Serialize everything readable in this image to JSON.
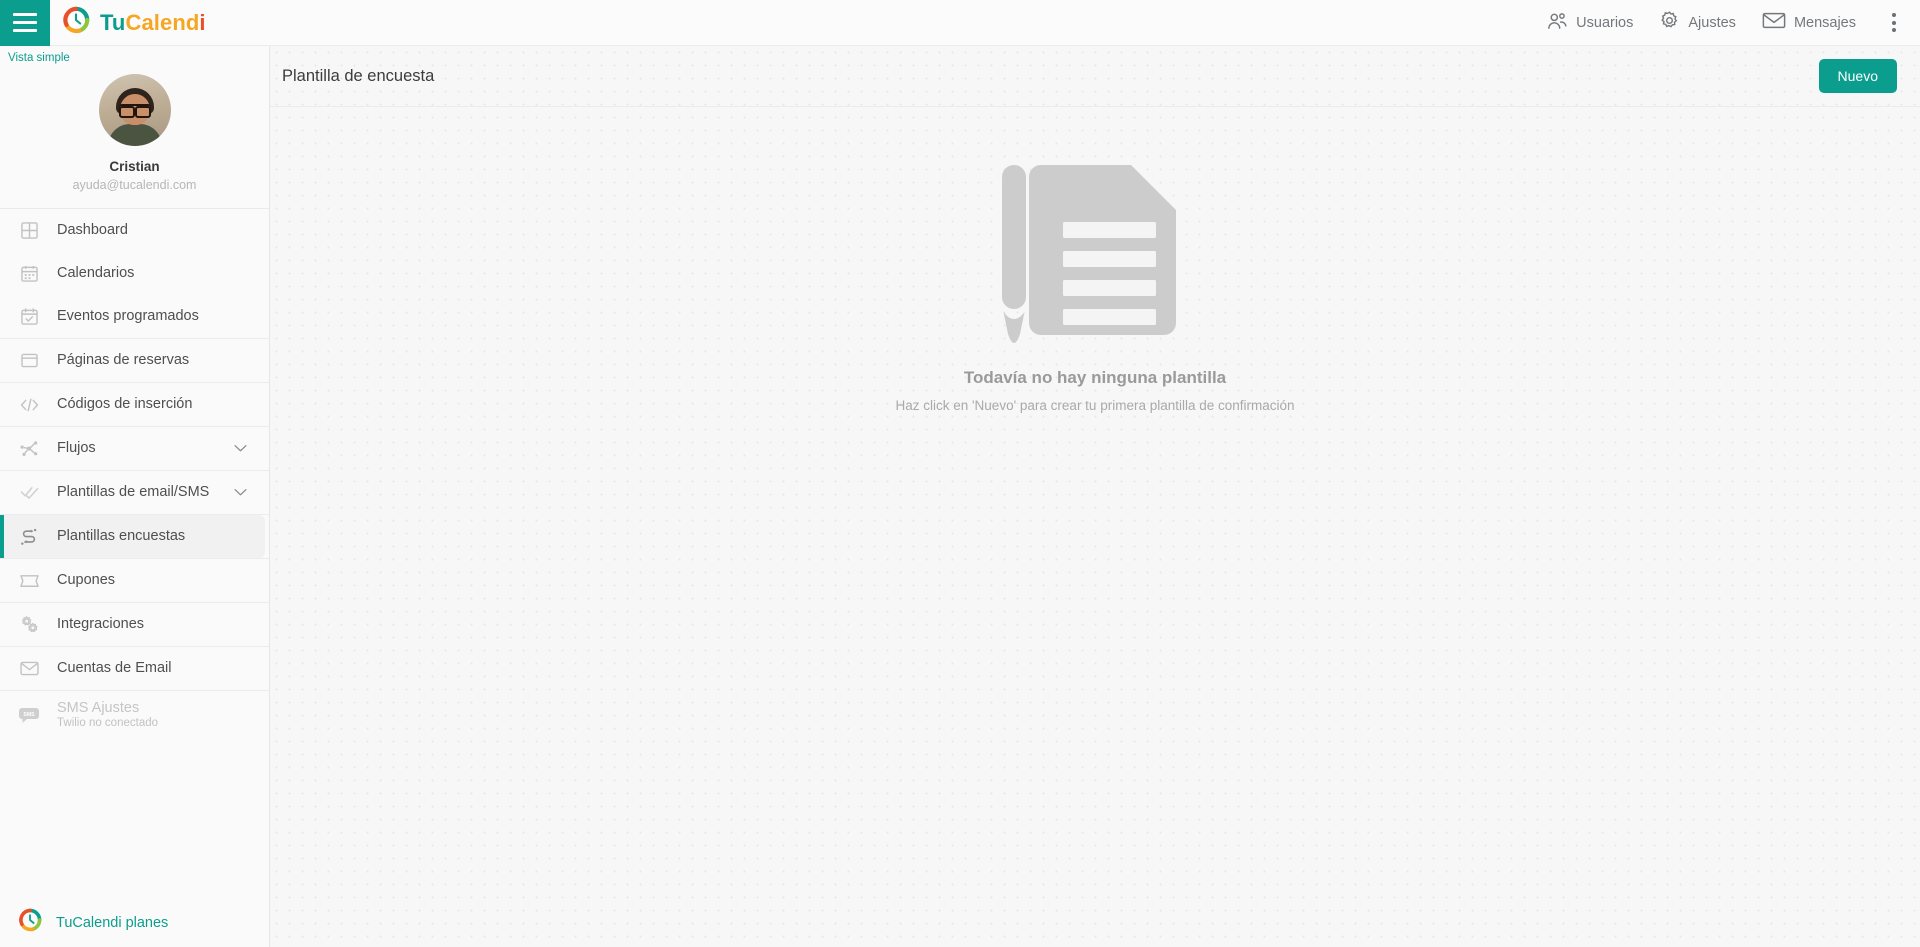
{
  "topbar": {
    "menu_icon": "hamburger-icon",
    "brand": {
      "part1": "Tu",
      "part2": "Calend",
      "part3": "i",
      "logo_icon": "tucalendi-logo-icon"
    },
    "actions": [
      {
        "label": "Usuarios",
        "icon": "users-icon"
      },
      {
        "label": "Ajustes",
        "icon": "gear-icon"
      },
      {
        "label": "Mensajes",
        "icon": "envelope-icon"
      }
    ],
    "overflow_icon": "kebab-menu-icon"
  },
  "sidebar": {
    "view_mode_label": "Vista simple",
    "profile": {
      "name": "Cristian",
      "email": "ayuda@tucalendi.com",
      "avatar_icon": "user-avatar"
    },
    "items": [
      {
        "label": "Dashboard",
        "icon": "grid-icon",
        "active": false,
        "disabled": false,
        "chevron": false
      },
      {
        "label": "Calendarios",
        "icon": "calendar-icon",
        "active": false,
        "disabled": false,
        "chevron": false
      },
      {
        "label": "Eventos programados",
        "icon": "event-check-icon",
        "active": false,
        "disabled": false,
        "chevron": false
      },
      {
        "label": "Páginas de reservas",
        "icon": "window-icon",
        "active": false,
        "disabled": false,
        "chevron": false
      },
      {
        "label": "Códigos de inserción",
        "icon": "code-icon",
        "active": false,
        "disabled": false,
        "chevron": false
      },
      {
        "label": "Flujos",
        "icon": "flow-icon",
        "active": false,
        "disabled": false,
        "chevron": true
      },
      {
        "label": "Plantillas de email/SMS",
        "icon": "double-check-icon",
        "active": false,
        "disabled": false,
        "chevron": true
      },
      {
        "label": "Plantillas encuestas",
        "icon": "survey-icon",
        "active": true,
        "disabled": false,
        "chevron": false
      },
      {
        "label": "Cupones",
        "icon": "ticket-icon",
        "active": false,
        "disabled": false,
        "chevron": false
      },
      {
        "label": "Integraciones",
        "icon": "gears-icon",
        "active": false,
        "disabled": false,
        "chevron": false
      },
      {
        "label": "Cuentas de Email",
        "icon": "envelope-icon",
        "active": false,
        "disabled": false,
        "chevron": false
      },
      {
        "label": "SMS Ajustes",
        "icon": "sms-bubble-icon",
        "active": false,
        "disabled": true,
        "chevron": false,
        "sublabel": "Twilio no conectado"
      }
    ],
    "plans_link": {
      "label": "TuCalendi planes",
      "icon": "tucalendi-logo-icon"
    }
  },
  "main": {
    "title": "Plantilla de encuesta",
    "new_button": "Nuevo",
    "empty_state": {
      "illustration_icon": "document-pencil-icon",
      "title": "Todavía no hay ninguna plantilla",
      "subtitle": "Haz click en 'Nuevo' para crear tu primera plantilla de confirmación"
    }
  },
  "colors": {
    "accent_teal": "#0b9e8e",
    "logo_orange": "#f5a623",
    "logo_red": "#e8502a",
    "logo_green": "#8cc63f",
    "background": "#f7f7f7"
  }
}
